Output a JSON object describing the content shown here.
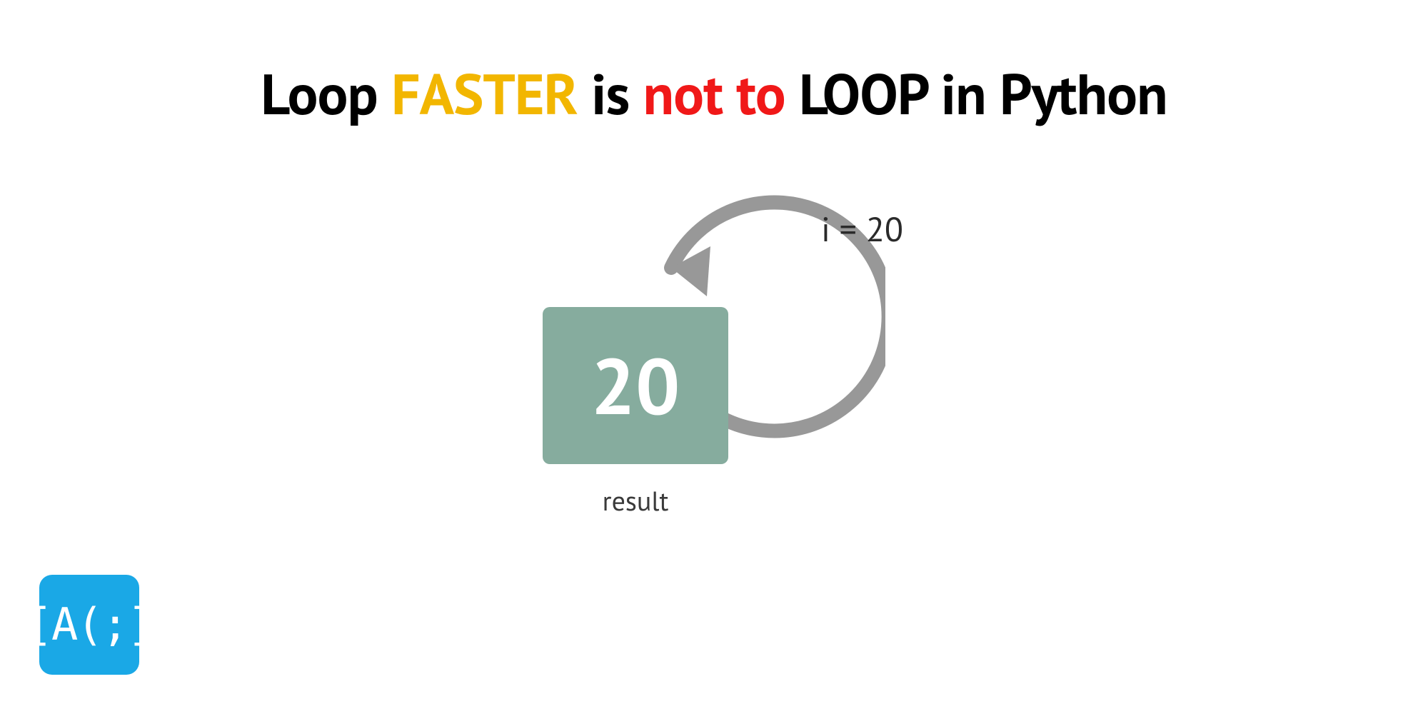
{
  "headline": {
    "w1": "Loop",
    "w2": "FASTER",
    "w3": "is",
    "w4": "not to",
    "w5": "LOOP in Python"
  },
  "diagram": {
    "box_value": "20",
    "box_label": "result",
    "iteration_label": "i = 20"
  },
  "logo": {
    "text": "[A(;]"
  },
  "colors": {
    "accent_yellow": "#f2b600",
    "accent_red": "#f01818",
    "box_green": "#86ac9e",
    "arrow_gray": "#989898",
    "logo_blue": "#1aa8e6"
  }
}
